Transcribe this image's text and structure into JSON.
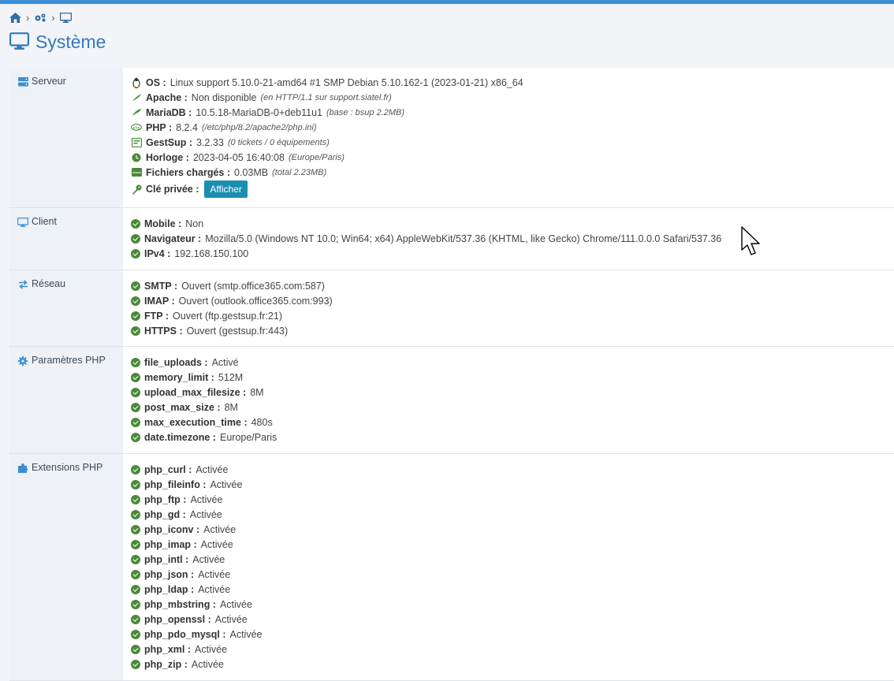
{
  "page": {
    "title": "Système"
  },
  "breadcrumb": {
    "items": [
      "home-icon",
      "cogs-icon",
      "desktop-icon"
    ]
  },
  "serveur": {
    "label": "Serveur",
    "rows": [
      {
        "key": "OS :",
        "value": "Linux support 5.10.0-21-amd64 #1 SMP Debian 5.10.162-1 (2023-01-21) x86_64",
        "note": ""
      },
      {
        "key": "Apache :",
        "value": "Non disponible",
        "note": "(en HTTP/1.1 sur support.siatel.fr)"
      },
      {
        "key": "MariaDB :",
        "value": "10.5.18-MariaDB-0+deb11u1",
        "note": "(base : bsup 2.2MB)"
      },
      {
        "key": "PHP :",
        "value": "8.2.4",
        "note": "(/etc/php/8.2/apache2/php.ini)"
      },
      {
        "key": "GestSup :",
        "value": "3.2.33",
        "note": "(0 tickets / 0 équipements)"
      },
      {
        "key": "Horloge :",
        "value": "2023-04-05 16:40:08",
        "note": "(Europe/Paris)"
      },
      {
        "key": "Fichiers chargés :",
        "value": "0.03MB",
        "note": "(total 2.23MB)"
      },
      {
        "key": "Clé privée :",
        "value": "",
        "note": ""
      }
    ],
    "show_button": "Afficher"
  },
  "client": {
    "label": "Client",
    "rows": [
      {
        "key": "Mobile :",
        "value": "Non"
      },
      {
        "key": "Navigateur :",
        "value": "Mozilla/5.0 (Windows NT 10.0; Win64; x64) AppleWebKit/537.36 (KHTML, like Gecko) Chrome/111.0.0.0 Safari/537.36"
      },
      {
        "key": "IPv4 :",
        "value": "192.168.150.100"
      }
    ]
  },
  "reseau": {
    "label": "Réseau",
    "rows": [
      {
        "key": "SMTP :",
        "value": "Ouvert (smtp.office365.com:587)"
      },
      {
        "key": "IMAP :",
        "value": "Ouvert (outlook.office365.com:993)"
      },
      {
        "key": "FTP :",
        "value": "Ouvert (ftp.gestsup.fr:21)"
      },
      {
        "key": "HTTPS :",
        "value": "Ouvert (gestsup.fr:443)"
      }
    ]
  },
  "php_params": {
    "label": "Paramètres PHP",
    "rows": [
      {
        "key": "file_uploads :",
        "value": "Activé"
      },
      {
        "key": "memory_limit :",
        "value": "512M"
      },
      {
        "key": "upload_max_filesize :",
        "value": "8M"
      },
      {
        "key": "post_max_size :",
        "value": "8M"
      },
      {
        "key": "max_execution_time :",
        "value": "480s"
      },
      {
        "key": "date.timezone :",
        "value": "Europe/Paris"
      }
    ]
  },
  "php_ext": {
    "label": "Extensions PHP",
    "rows": [
      {
        "key": "php_curl :",
        "value": "Activée"
      },
      {
        "key": "php_fileinfo :",
        "value": "Activée"
      },
      {
        "key": "php_ftp :",
        "value": "Activée"
      },
      {
        "key": "php_gd :",
        "value": "Activée"
      },
      {
        "key": "php_iconv :",
        "value": "Activée"
      },
      {
        "key": "php_imap :",
        "value": "Activée"
      },
      {
        "key": "php_intl :",
        "value": "Activée"
      },
      {
        "key": "php_json :",
        "value": "Activée"
      },
      {
        "key": "php_ldap :",
        "value": "Activée"
      },
      {
        "key": "php_mbstring :",
        "value": "Activée"
      },
      {
        "key": "php_openssl :",
        "value": "Activée"
      },
      {
        "key": "php_pdo_mysql :",
        "value": "Activée"
      },
      {
        "key": "php_xml :",
        "value": "Activée"
      },
      {
        "key": "php_zip :",
        "value": "Activée"
      }
    ]
  },
  "colors": {
    "accent": "#3a8fd6",
    "ok": "#4a8a3a",
    "button": "#1a8fb0"
  }
}
